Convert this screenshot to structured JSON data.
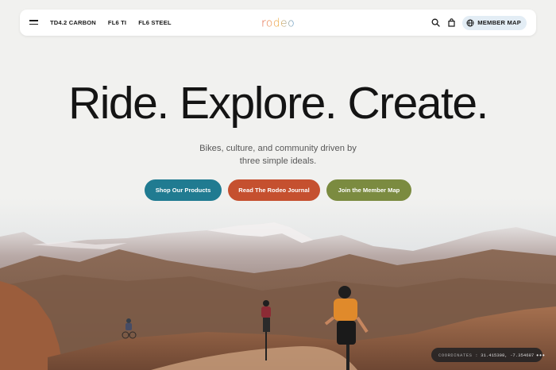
{
  "nav": {
    "links": [
      "TD4.2 CARBON",
      "FL6 TI",
      "FL6 STEEL"
    ],
    "logo_text": "rodeo",
    "member_map_label": "MEMBER MAP",
    "icons": [
      "menu-icon",
      "search-icon",
      "cart-icon",
      "globe-icon"
    ]
  },
  "hero": {
    "headline": "Ride. Explore. Create.",
    "subtitle": "Bikes, culture, and community driven by three simple ideals.",
    "ctas": [
      {
        "label": "Shop Our Products",
        "color": "#207b91"
      },
      {
        "label": "Read The Rodeo Journal",
        "color": "#c5502f"
      },
      {
        "label": "Join the Member Map",
        "color": "#7b8b40"
      }
    ]
  },
  "coordinates": {
    "label": "COORDINATES :",
    "value": "31.415308, -7.354687",
    "more": "•••"
  },
  "colors": {
    "background": "#f1f1ef",
    "logo_gradient": [
      "#e15b42",
      "#f0a93b",
      "#4b8fc9"
    ],
    "member_button_bg": "#e3edf5"
  }
}
